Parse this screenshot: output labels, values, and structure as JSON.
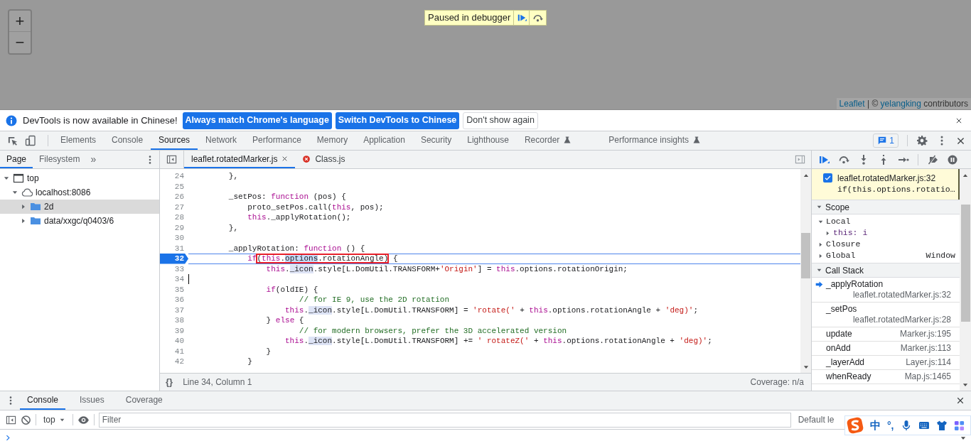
{
  "viewport": {
    "zoom_in": "+",
    "zoom_out": "−",
    "paused_banner": "Paused in debugger",
    "attribution": [
      {
        "text": "Leaflet",
        "link": true
      },
      {
        "text": " | © ",
        "link": false
      },
      {
        "text": "yelangking",
        "link": true
      },
      {
        "text": " contributors",
        "link": false
      }
    ]
  },
  "infobar": {
    "message": "DevTools is now available in Chinese!",
    "buttons": [
      {
        "label": "Always match Chrome's language",
        "primary": true
      },
      {
        "label": "Switch DevTools to Chinese",
        "primary": true
      },
      {
        "label": "Don't show again",
        "primary": false
      }
    ]
  },
  "main_tabs": [
    {
      "label": "Elements",
      "selected": false,
      "experimental": false
    },
    {
      "label": "Console",
      "selected": false,
      "experimental": false
    },
    {
      "label": "Sources",
      "selected": true,
      "experimental": false
    },
    {
      "label": "Network",
      "selected": false,
      "experimental": false
    },
    {
      "label": "Performance",
      "selected": false,
      "experimental": false
    },
    {
      "label": "Memory",
      "selected": false,
      "experimental": false
    },
    {
      "label": "Application",
      "selected": false,
      "experimental": false
    },
    {
      "label": "Security",
      "selected": false,
      "experimental": false
    },
    {
      "label": "Lighthouse",
      "selected": false,
      "experimental": false
    },
    {
      "label": "Recorder",
      "selected": false,
      "experimental": true
    },
    {
      "label": "Performance insights",
      "selected": false,
      "experimental": true
    }
  ],
  "issues_count": "1",
  "navigator": {
    "tabs": [
      {
        "label": "Page",
        "selected": true
      },
      {
        "label": "Filesystem",
        "selected": false
      }
    ],
    "more": "»",
    "tree": [
      {
        "kind": "frame",
        "label": "top",
        "expanded": true,
        "selected": false,
        "children": [
          {
            "kind": "origin",
            "label": "localhost:8086",
            "expanded": true,
            "selected": false,
            "children": [
              {
                "kind": "folder",
                "label": "2d",
                "expanded": false,
                "selected": true
              },
              {
                "kind": "folder",
                "label": "data/xxgc/q0403/6",
                "expanded": false,
                "selected": false
              }
            ]
          }
        ]
      }
    ]
  },
  "editor": {
    "tabs": [
      {
        "label": "leaflet.rotatedMarker.js",
        "selected": true,
        "closable": true,
        "error": false
      },
      {
        "label": "Class.js",
        "selected": false,
        "closable": false,
        "error": true
      }
    ],
    "lines": [
      {
        "number": "24",
        "paused": false,
        "cursor": false,
        "tokens": [
          {
            "kind": "plain",
            "text": "        },"
          }
        ]
      },
      {
        "number": "25",
        "paused": false,
        "cursor": false
      },
      {
        "number": "26",
        "paused": false,
        "cursor": false,
        "tokens": [
          {
            "kind": "plain",
            "text": "        _setPos: "
          },
          {
            "kind": "keyword",
            "text": "function"
          },
          {
            "kind": "plain",
            "text": " (pos) {"
          }
        ]
      },
      {
        "number": "27",
        "paused": false,
        "cursor": false,
        "tokens": [
          {
            "kind": "plain",
            "text": "            proto_setPos.call("
          },
          {
            "kind": "keyword",
            "text": "this"
          },
          {
            "kind": "plain",
            "text": ", pos);"
          }
        ]
      },
      {
        "number": "28",
        "paused": false,
        "cursor": false,
        "tokens": [
          {
            "kind": "keyword",
            "text": "            this"
          },
          {
            "kind": "plain",
            "text": "._applyRotation();"
          }
        ]
      },
      {
        "number": "29",
        "paused": false,
        "cursor": false,
        "tokens": [
          {
            "kind": "plain",
            "text": "        },"
          }
        ]
      },
      {
        "number": "30",
        "paused": false,
        "cursor": false
      },
      {
        "number": "31",
        "paused": false,
        "cursor": false,
        "tokens": [
          {
            "kind": "plain",
            "text": "        _applyRotation: "
          },
          {
            "kind": "keyword",
            "text": "function"
          },
          {
            "kind": "plain",
            "text": " () {"
          }
        ]
      },
      {
        "number": "32",
        "paused": true,
        "cursor": false,
        "tokens": [
          {
            "kind": "keyword",
            "text": "            if"
          },
          {
            "kind": "boxed",
            "tokens": [
              {
                "kind": "plain",
                "text": "("
              },
              {
                "kind": "keyword",
                "text": "this"
              },
              {
                "kind": "plain",
                "text": "."
              },
              {
                "kind": "selection",
                "text": "options"
              },
              {
                "kind": "plain",
                "text": ".rotationAngle)"
              }
            ]
          },
          {
            "kind": "plain",
            "text": " {"
          }
        ]
      },
      {
        "number": "33",
        "paused": false,
        "cursor": false,
        "tokens": [
          {
            "kind": "keyword",
            "text": "                this"
          },
          {
            "kind": "plain",
            "text": "."
          },
          {
            "kind": "highlight",
            "text": "_icon"
          },
          {
            "kind": "plain",
            "text": ".style[L.DomUtil.TRANSFORM+"
          },
          {
            "kind": "string",
            "text": "'Origin'"
          },
          {
            "kind": "plain",
            "text": "] = "
          },
          {
            "kind": "keyword",
            "text": "this"
          },
          {
            "kind": "plain",
            "text": ".options.rotationOrigin;"
          }
        ]
      },
      {
        "number": "34",
        "paused": false,
        "cursor": true
      },
      {
        "number": "35",
        "paused": false,
        "cursor": false,
        "tokens": [
          {
            "kind": "keyword",
            "text": "                if"
          },
          {
            "kind": "plain",
            "text": "(oldIE) {"
          }
        ]
      },
      {
        "number": "36",
        "paused": false,
        "cursor": false,
        "tokens": [
          {
            "kind": "comment",
            "text": "                       // for IE 9, use the 2D rotation"
          }
        ]
      },
      {
        "number": "37",
        "paused": false,
        "cursor": false,
        "tokens": [
          {
            "kind": "keyword",
            "text": "                    this"
          },
          {
            "kind": "plain",
            "text": "."
          },
          {
            "kind": "highlight",
            "text": "_icon"
          },
          {
            "kind": "plain",
            "text": ".style[L.DomUtil.TRANSFORM] = "
          },
          {
            "kind": "string",
            "text": "'rotate('"
          },
          {
            "kind": "plain",
            "text": " + "
          },
          {
            "kind": "keyword",
            "text": "this"
          },
          {
            "kind": "plain",
            "text": ".options.rotationAngle + "
          },
          {
            "kind": "string",
            "text": "'deg)'"
          },
          {
            "kind": "plain",
            "text": ";"
          }
        ]
      },
      {
        "number": "38",
        "paused": false,
        "cursor": false,
        "tokens": [
          {
            "kind": "plain",
            "text": "                } "
          },
          {
            "kind": "keyword",
            "text": "else"
          },
          {
            "kind": "plain",
            "text": " {"
          }
        ]
      },
      {
        "number": "39",
        "paused": false,
        "cursor": false,
        "tokens": [
          {
            "kind": "comment",
            "text": "                       // for modern browsers, prefer the 3D accelerated version"
          }
        ]
      },
      {
        "number": "40",
        "paused": false,
        "cursor": false,
        "tokens": [
          {
            "kind": "keyword",
            "text": "                    this"
          },
          {
            "kind": "plain",
            "text": "."
          },
          {
            "kind": "highlight",
            "text": "_icon"
          },
          {
            "kind": "plain",
            "text": ".style[L.DomUtil.TRANSFORM] += "
          },
          {
            "kind": "string",
            "text": "' rotateZ('"
          },
          {
            "kind": "plain",
            "text": " + "
          },
          {
            "kind": "keyword",
            "text": "this"
          },
          {
            "kind": "plain",
            "text": ".options.rotationAngle + "
          },
          {
            "kind": "string",
            "text": "'deg)'"
          },
          {
            "kind": "plain",
            "text": ";"
          }
        ]
      },
      {
        "number": "41",
        "paused": false,
        "cursor": false,
        "tokens": [
          {
            "kind": "plain",
            "text": "                }"
          }
        ]
      },
      {
        "number": "42",
        "paused": false,
        "cursor": false,
        "tokens": [
          {
            "kind": "plain",
            "text": "            }"
          }
        ]
      }
    ],
    "pretty_print": "{}",
    "status": "Line 34, Column 1",
    "coverage": "Coverage: n/a"
  },
  "debugger": {
    "breakpoint": {
      "checked": true,
      "location": "leaflet.rotatedMarker.js:32",
      "code": "if(this.options.rotatio…"
    },
    "scope": {
      "title": "Scope",
      "expanded": true,
      "items": [
        {
          "name": "Local",
          "expanded": true,
          "children": [
            {
              "name": "this: i",
              "expanded": false
            }
          ]
        },
        {
          "name": "Closure",
          "expanded": false
        },
        {
          "name": "Global",
          "value": "Window",
          "expanded": false
        }
      ]
    },
    "call_stack": {
      "title": "Call Stack",
      "expanded": true,
      "frames": [
        {
          "name": "_applyRotation",
          "location": "leaflet.rotatedMarker.js:32",
          "selected": true
        },
        {
          "name": "_setPos",
          "location": "leaflet.rotatedMarker.js:28",
          "selected": false
        },
        {
          "name": "update",
          "location": "Marker.js:195",
          "selected": false
        },
        {
          "name": "onAdd",
          "location": "Marker.js:113",
          "selected": false
        },
        {
          "name": "_layerAdd",
          "location": "Layer.js:114",
          "selected": false
        },
        {
          "name": "whenReady",
          "location": "Map.js:1465",
          "selected": false
        }
      ]
    }
  },
  "drawer": {
    "tabs": [
      {
        "label": "Console",
        "selected": true
      },
      {
        "label": "Issues",
        "selected": false
      },
      {
        "label": "Coverage",
        "selected": false
      }
    ],
    "context": "top",
    "filter_placeholder": "Filter",
    "levels": "Default le"
  },
  "ime": {
    "mode": "中",
    "punctuation": "°,"
  }
}
